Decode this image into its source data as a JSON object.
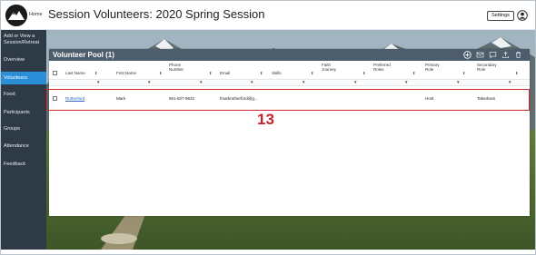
{
  "header": {
    "home_label": "Home",
    "title": "Session Volunteers: 2020 Spring Session",
    "settings_label": "Settings",
    "logo_icon": "mountain-logo-icon",
    "user_icon": "user-circle-icon"
  },
  "sidebar": {
    "items": [
      {
        "label_line1": "Add or View a",
        "label_line2": "Session/Retreat"
      },
      {
        "label": "Overview"
      },
      {
        "label": "Volunteers",
        "active": true
      },
      {
        "label": "Food"
      },
      {
        "label": "Participants"
      },
      {
        "label": "Groups"
      },
      {
        "label": "Attendance"
      },
      {
        "label": "Feedback"
      }
    ]
  },
  "panel": {
    "title": "Volunteer Pool (1)",
    "toolbar_icons": [
      "add-circle-icon",
      "email-icon",
      "comment-icon",
      "upload-icon",
      "delete-icon"
    ],
    "columns": [
      {
        "line1": "Last Name",
        "line2": ""
      },
      {
        "line1": "First Name",
        "line2": ""
      },
      {
        "line1": "Phone",
        "line2": "Number"
      },
      {
        "line1": "Email",
        "line2": ""
      },
      {
        "line1": "Skills",
        "line2": ""
      },
      {
        "line1": "Faith",
        "line2": "Journey"
      },
      {
        "line1": "Preferred",
        "line2": "Roles"
      },
      {
        "line1": "Primary",
        "line2": "Role"
      },
      {
        "line1": "Secondary",
        "line2": "Role"
      }
    ],
    "sort_glyph": "⬍",
    "filter_glyph": "▼",
    "rows": [
      {
        "last_name": "Rutherford",
        "first_name": "Mark",
        "phone": "561-827-9632",
        "email": "fmarkrutherford@g...",
        "skills": "",
        "faith_journey": "",
        "preferred_roles": "",
        "primary_role": "Host",
        "secondary_role": "Takedown"
      }
    ]
  },
  "annotation": {
    "number": "13",
    "color": "#c8212a"
  },
  "colors": {
    "sidebar_bg": "#2e3b47",
    "sidebar_active": "#2a8fd6",
    "panel_header": "#4d5d6b",
    "link": "#2a62c9"
  }
}
